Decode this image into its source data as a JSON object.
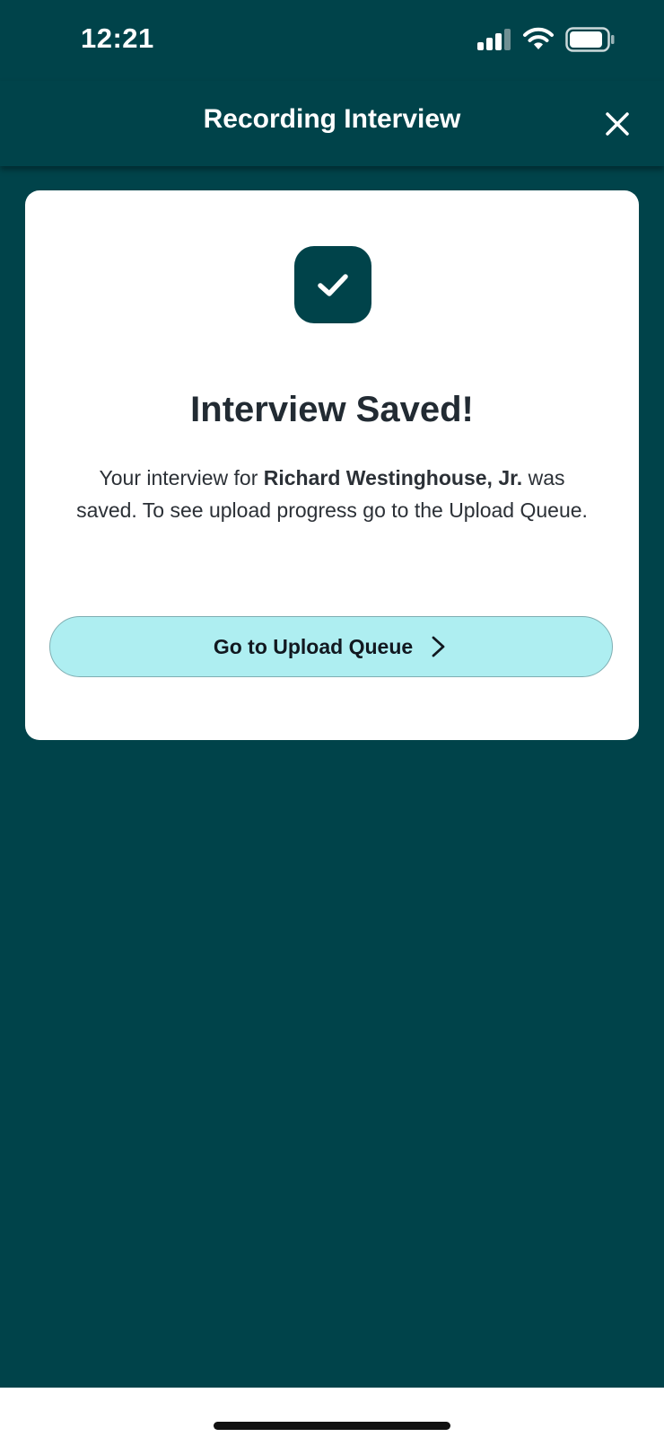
{
  "status_bar": {
    "time": "12:21"
  },
  "header": {
    "title": "Recording Interview"
  },
  "card": {
    "title": "Interview Saved!",
    "message_prefix": "Your interview for ",
    "candidate_name": "Richard Westinghouse, Jr.",
    "message_suffix": " was saved. To see upload progress go to the Upload Queue.",
    "button_label": "Go to Upload Queue"
  },
  "icons": {
    "close": "close-icon",
    "check": "check-icon",
    "chevron": "chevron-right-icon"
  },
  "colors": {
    "primary": "#00434a",
    "button_bg": "#aeeef1",
    "card_bg": "#ffffff"
  }
}
